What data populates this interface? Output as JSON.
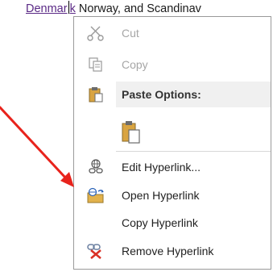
{
  "document": {
    "link_text": "Denmar",
    "link_text_after_caret": "k",
    "following_text": " Norway, and Scandinav"
  },
  "context_menu": {
    "items": [
      {
        "label": "Cut",
        "icon": "scissors-icon",
        "enabled": false
      },
      {
        "label": "Copy",
        "icon": "copy-icon",
        "enabled": false
      },
      {
        "label": "Paste Options:",
        "icon": "clipboard-icon",
        "enabled": true
      },
      {
        "label": "",
        "icon": "paste-keep-formatting-icon",
        "enabled": true
      },
      {
        "label": "Edit Hyperlink...",
        "icon": "edit-hyperlink-icon",
        "enabled": true
      },
      {
        "label": "Open Hyperlink",
        "icon": "open-hyperlink-icon",
        "enabled": true
      },
      {
        "label": "Copy Hyperlink",
        "icon": "",
        "enabled": true
      },
      {
        "label": "Remove Hyperlink",
        "icon": "remove-hyperlink-icon",
        "enabled": true
      }
    ]
  },
  "annotation": {
    "arrow_color": "#e8231c",
    "target": "Open Hyperlink"
  },
  "colors": {
    "link": "#5b2a86",
    "disabled_text": "#a6a6a6",
    "header_bg": "#f0f0f0"
  }
}
